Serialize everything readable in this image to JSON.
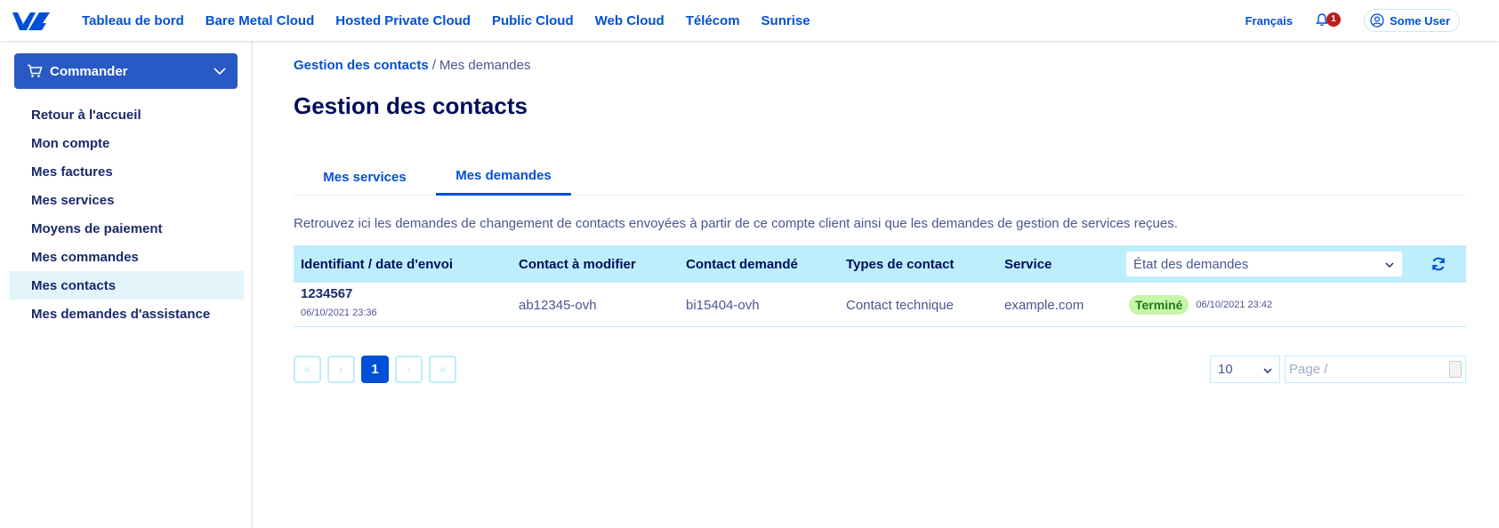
{
  "topbar": {
    "nav": [
      "Tableau de bord",
      "Bare Metal Cloud",
      "Hosted Private Cloud",
      "Public Cloud",
      "Web Cloud",
      "Télécom",
      "Sunrise"
    ],
    "language": "Français",
    "notification_count": "1",
    "user_name": "Some User"
  },
  "sidebar": {
    "order_label": "Commander",
    "items": [
      {
        "label": "Retour à l'accueil"
      },
      {
        "label": "Mon compte"
      },
      {
        "label": "Mes factures"
      },
      {
        "label": "Mes services"
      },
      {
        "label": "Moyens de paiement"
      },
      {
        "label": "Mes commandes"
      },
      {
        "label": "Mes contacts",
        "active": true
      },
      {
        "label": "Mes demandes d'assistance"
      }
    ]
  },
  "breadcrumb": {
    "parent": "Gestion des contacts",
    "separator": "/",
    "current": "Mes demandes"
  },
  "page": {
    "title": "Gestion des contacts",
    "intro": "Retrouvez ici les demandes de changement de contacts envoyées à partir de ce compte client ainsi que les demandes de gestion de services reçues."
  },
  "tabs": [
    {
      "label": "Mes services",
      "active": false
    },
    {
      "label": "Mes demandes",
      "active": true
    }
  ],
  "table": {
    "headers": {
      "id": "Identifiant / date d'envoi",
      "contact_change": "Contact à modifier",
      "contact_requested": "Contact demandé",
      "contact_types": "Types de contact",
      "service": "Service"
    },
    "status_filter": "État des demandes",
    "rows": [
      {
        "id": "1234567",
        "sent_date": "06/10/2021 23:36",
        "contact_change": "ab12345-ovh",
        "contact_requested": "bi15404-ovh",
        "contact_type": "Contact technique",
        "service": "example.com",
        "status": "Terminé",
        "status_date": "06/10/2021 23:42"
      }
    ]
  },
  "pagination": {
    "first": "«",
    "prev": "‹",
    "current": "1",
    "next": "›",
    "last": "»",
    "per_page": "10",
    "page_placeholder": "Page  /"
  },
  "colors": {
    "primary": "#0050d7",
    "header_bg": "#bdeefb",
    "badge_success": "#c7f6a9",
    "order_button": "#2859c5"
  }
}
